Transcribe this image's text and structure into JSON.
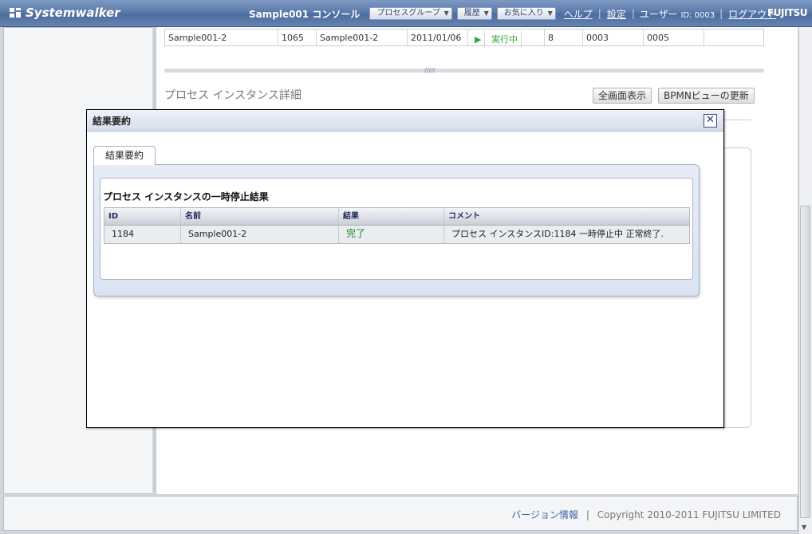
{
  "header": {
    "brand": "Systemwalker",
    "console": "Sample001 コンソール",
    "menus": [
      "プロセスグループ",
      "履歴",
      "お気に入り"
    ],
    "help": "ヘルプ",
    "settings": "設定",
    "user_label": "ユーザー",
    "user_id": "ID: 0003",
    "logout": "ログアウト",
    "vendor": "FUJITSU"
  },
  "background": {
    "row": [
      "Sample001-2",
      "1065",
      "Sample001-2",
      "2011/01/06",
      "実行中",
      "8",
      "0003",
      "0005"
    ],
    "detail_title": "プロセス インスタンス詳細",
    "btn_fullscreen": "全画面表示",
    "btn_bpmn_refresh": "BPMNビューの更新"
  },
  "modal": {
    "title": "結果要約",
    "tab_label": "結果要約",
    "heading": "プロセス インスタンスの一時停止結果",
    "columns": [
      "ID",
      "名前",
      "結果",
      "コメント"
    ],
    "rows": [
      {
        "id": "1184",
        "name": "Sample001-2",
        "result": "完了",
        "comment": "プロセス インスタンスID:1184 一時停止中 正常終了."
      }
    ],
    "close_icon": "close-icon"
  },
  "footer": {
    "version_link": "バージョン情報",
    "separator": "|",
    "copyright": "Copyright 2010-2011 FUJITSU LIMITED"
  },
  "colors": {
    "header_blue": "#5c7bab",
    "status_green": "#1d8a2a",
    "link_blue": "#3f63a8"
  }
}
